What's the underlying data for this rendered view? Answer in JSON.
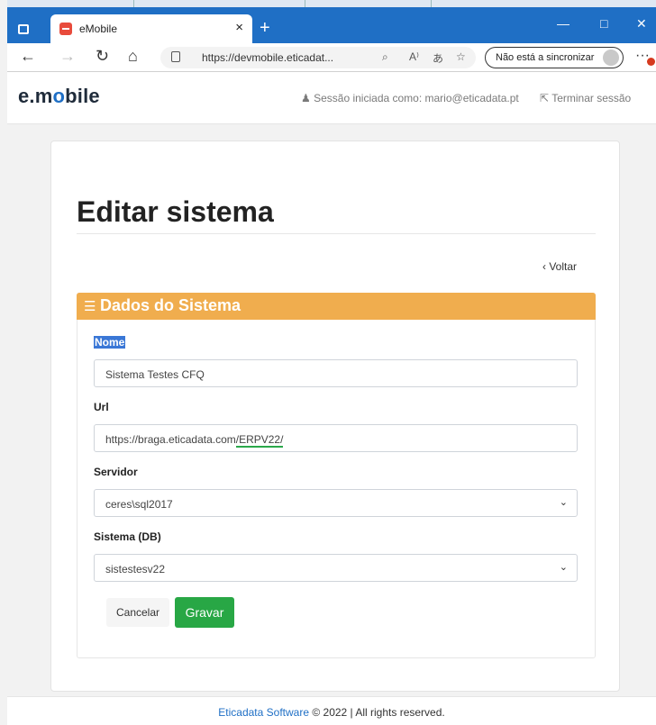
{
  "browser": {
    "tab_title": "eMobile",
    "tab_close": "×",
    "new_tab": "+",
    "url": "https://devmobile.eticadat...",
    "sync_label": "Não está a sincronizar",
    "more": "···",
    "minimize": "—",
    "maximize": "□",
    "close": "✕",
    "back": "←",
    "forward": "→",
    "refresh": "↻",
    "home": "⌂",
    "reader_icon": "A⁾",
    "translate_icon": "あ",
    "search_icon": "⌕",
    "fav_icon": "☆"
  },
  "navbar": {
    "brand_prefix": "e.m",
    "brand_dot": "o",
    "brand_suffix": "bile",
    "session_text": "Sessão iniciada como: mario@eticadata.pt",
    "logout_text": "Terminar sessão"
  },
  "form": {
    "page_title": "Editar sistema",
    "back_label": "Voltar",
    "panel_title": "Dados do Sistema",
    "fields": {
      "nome_label": "Nome",
      "nome_value": "Sistema Testes CFQ",
      "url_label": "Url",
      "url_value_prefix": "https://braga.eticadata.com",
      "url_value_suffix": "/ERPV22/",
      "servidor_label": "Servidor",
      "servidor_value": "ceres\\sql2017",
      "sistema_label": "Sistema (DB)",
      "sistema_value": "sistestesv22"
    },
    "cancel_label": "Cancelar",
    "save_label": "Gravar"
  },
  "footer": {
    "company": "Eticadata Software",
    "rest": " © 2022 | All rights reserved."
  },
  "colors": {
    "browser_blue": "#1f6fc5",
    "panel_header": "#f0ad4e",
    "save_green": "#28a745"
  }
}
